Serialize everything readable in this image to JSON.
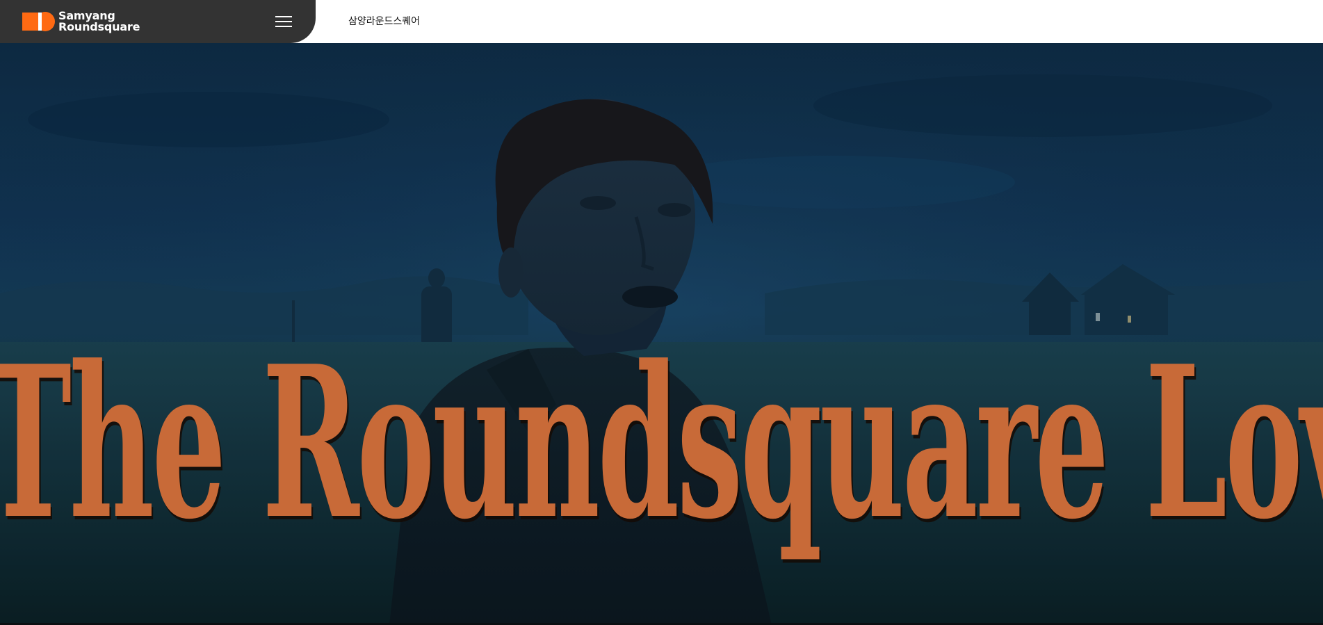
{
  "header": {
    "logo": {
      "line1": "Samyang",
      "line2": "Roundsquare",
      "icon": "samyang-roundsquare-logo-icon",
      "accent_color": "#ff6a13"
    },
    "menu_button": {
      "icon": "hamburger-menu-icon"
    },
    "site_title": "삼양라운드스퀘어"
  },
  "hero": {
    "title": "The Roundsquare Love",
    "title_color": "#c86a38",
    "background": "dark-blue-night-field-photo"
  }
}
